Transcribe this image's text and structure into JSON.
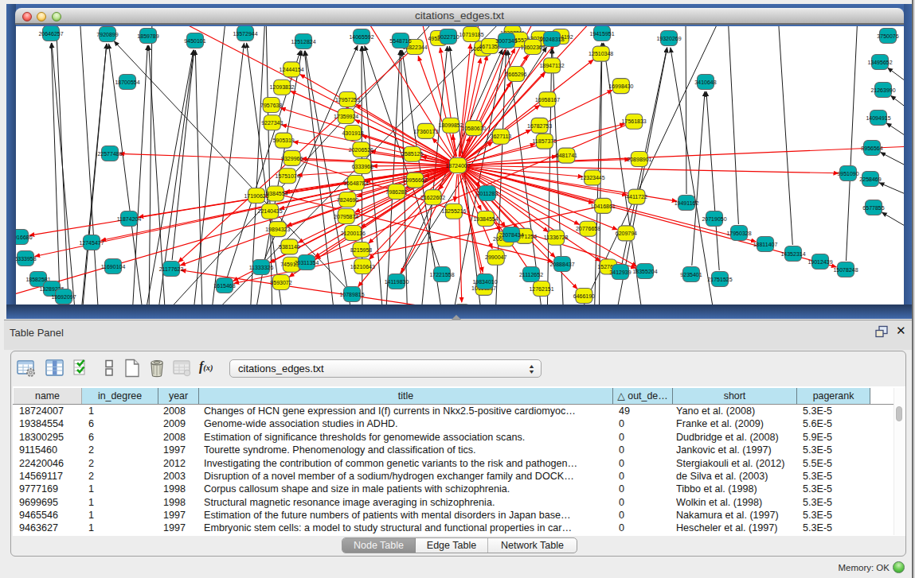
{
  "window": {
    "title": "citations_edges.txt"
  },
  "network_view": {
    "background": "#ffffff",
    "frame_color": "#3c61a0",
    "node_fill_default": "#00acad",
    "node_fill_highlight": "#f0f000",
    "edge_color_default": "#1a1a1a",
    "edge_color_highlight": "#f20400",
    "hub_label": "18724007",
    "featured_node_labels": [
      "19384554",
      "15751074",
      "9329966",
      "9227343",
      "12093832",
      "12444154",
      "16210643",
      "8215958",
      "16648784",
      "20206526",
      "17359924",
      "17957253",
      "16958167",
      "16782753",
      "12323445",
      "20691406",
      "10653287",
      "1527602",
      "6466190",
      "10719185",
      "4671358",
      "7515526"
    ]
  },
  "table_panel": {
    "title": "Table Panel",
    "toolbar": {
      "icons": [
        "table-settings",
        "show-columns",
        "select-columns",
        "column-chooser",
        "new-table",
        "delete-table",
        "import-table-disabled",
        "function-builder"
      ],
      "network_selector_value": "citations_edges.txt"
    },
    "table": {
      "columns": [
        "name",
        "in_degree",
        "year",
        "title",
        "out_de…",
        "short",
        "pagerank"
      ],
      "sort_indicator": "△",
      "sort_column_index": 4,
      "rows": [
        [
          "18724007",
          "1",
          "2008",
          "Changes of HCN gene expression and I(f) currents in Nkx2.5-positive cardiomyoc…",
          "49",
          "Yano et al. (2008)",
          "5.3E-5"
        ],
        [
          "19384554",
          "6",
          "2009",
          "Genome-wide association studies in ADHD.",
          "0",
          "Franke et al. (2009)",
          "5.6E-5"
        ],
        [
          "18300295",
          "6",
          "2008",
          "Estimation of significance thresholds for genomewide association scans.",
          "0",
          "Dudbridge et al. (2008)",
          "5.9E-5"
        ],
        [
          "9115460",
          "2",
          "1997",
          "Tourette syndrome. Phenomenology and classification of tics.",
          "0",
          "Jankovic et al. (1997)",
          "5.3E-5"
        ],
        [
          "22420046",
          "2",
          "2012",
          "Investigating the contribution of common genetic variants to the risk and pathogen…",
          "0",
          "Stergiakouli et al. (2012)",
          "5.5E-5"
        ],
        [
          "14569117",
          "2",
          "2003",
          "Disruption of a novel member of a sodium/hydrogen exchanger family and DOCK…",
          "0",
          "de Silva et al. (2003)",
          "5.3E-5"
        ],
        [
          "9777169",
          "1",
          "1998",
          "Corpus callosum shape and size in male patients with schizophrenia.",
          "0",
          "Tibbo et al. (1998)",
          "5.3E-5"
        ],
        [
          "9699695",
          "1",
          "1998",
          "Structural magnetic resonance image averaging in schizophrenia.",
          "0",
          "Wolkin et al. (1998)",
          "5.3E-5"
        ],
        [
          "9465546",
          "1",
          "1997",
          "Estimation of the future numbers of patients with mental disorders in Japan base…",
          "0",
          "Nakamura et al. (1997)",
          "5.3E-5"
        ],
        [
          "9463627",
          "1",
          "1997",
          "Embryonic stem cells: a model to study structural and functional properties in car…",
          "0",
          "Hescheler et al. (1997)",
          "5.3E-5"
        ]
      ]
    },
    "tabs": [
      {
        "label": "Node Table",
        "active": true
      },
      {
        "label": "Edge Table",
        "active": false
      },
      {
        "label": "Network Table",
        "active": false
      }
    ]
  },
  "status": {
    "memory_label": "Memory: OK"
  }
}
